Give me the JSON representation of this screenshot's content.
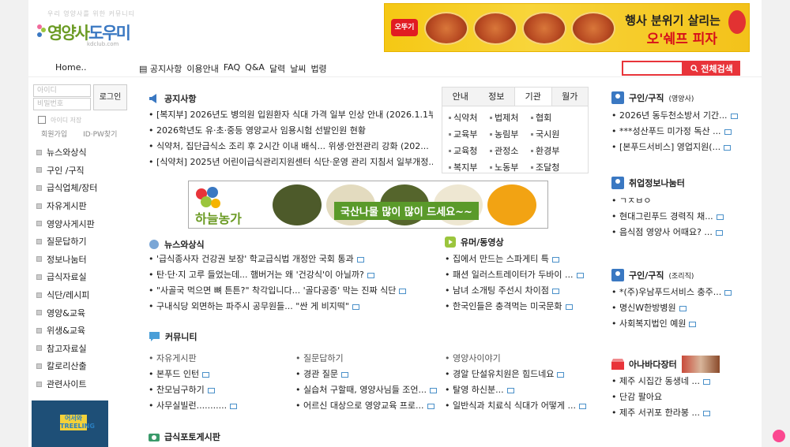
{
  "logo": {
    "tagline": "우리 영양사를 위한 커뮤니티",
    "name_part1": "영양사",
    "name_part2": "도우미",
    "domain": "kdclub.com"
  },
  "top_banner": {
    "brand": "오뚜기",
    "line1": "행사 분위기 살리는",
    "line2": "오'쉐프 피자"
  },
  "nav": {
    "home": "Home..",
    "menu": [
      "공지사항",
      "이용안내",
      "FAQ",
      "Q&A",
      "달력",
      "날씨",
      "법령"
    ]
  },
  "search": {
    "button": "전체검색",
    "placeholder": ""
  },
  "login": {
    "id_placeholder": "아이디",
    "pw_placeholder": "비밀번호",
    "button": "로그인",
    "save_label": "아이디 저장",
    "signup": "회원가입",
    "find": "ID·PW찾기"
  },
  "sidebar": {
    "items": [
      "뉴스와상식",
      "구인 /구직",
      "급식업체/장터",
      "자유게시판",
      "영양사게시판",
      "질문답하기",
      "정보나눔터",
      "급식자료실",
      "식단/레시피",
      "영양&교육",
      "위생&교육",
      "참고자료실",
      "칼로리산출",
      "관련사이트"
    ]
  },
  "side_banner": {
    "text": "어서와 TREELING"
  },
  "notice": {
    "title": "공지사항",
    "rows": [
      "[복지부] 2026년도 병의원 입원환자 식대 가격 일부 인상 안내 (2026.1.1부..",
      "2026학년도 유·초·중등 영양교사 임용시험 선발인원 현황",
      "식약처, 집단급식소 조리 후 2시간 이내 배식... 위생·안전관리 강화 (202...",
      "[식약처] 2025년 어린이급식관리지원센터 식단·운영 관리 지침서 일부개정..."
    ]
  },
  "info_tabs": {
    "tabs": [
      "안내",
      "정보",
      "기관",
      "월가"
    ],
    "active": 2,
    "items": [
      "식약처",
      "법제처",
      "협회",
      "교육부",
      "농림부",
      "국시원",
      "교육청",
      "관정소",
      "환경부",
      "복지부",
      "노동부",
      "조달청"
    ]
  },
  "mid_banner": {
    "logo": "하늘농가",
    "slogan": "국산나물 많이 많이 드세요~~"
  },
  "news": {
    "title": "뉴스와상식",
    "rows": [
      "'급식종사자 건강권 보장' 학교급식법 개정안 국회 통과",
      "탄·단·지 고루 들었는데... 햄버거는 왜 '건강식'이 아닐까?",
      "\"사골국 먹으면 뼈 튼튼?\" 착각입니다... '골다공증' 막는 진짜 식단",
      "구내식당 외면하는 파주시 공무원들... \"싼 게 비지떡\""
    ]
  },
  "humor": {
    "title": "유머/동영상",
    "rows": [
      "집에서 만드는 스파게티 특",
      "패션 일러스트레이터가 두바이 ...",
      "남녀 소개팅 주선시 차이점",
      "한국인들은 충격먹는 미국문화"
    ]
  },
  "community": {
    "title": "커뮤니티",
    "columns": [
      {
        "title": "자유게시판",
        "rows": [
          "본푸드 인턴",
          "찬모님구하기",
          "사무실빌런..........."
        ]
      },
      {
        "title": "질문답하기",
        "rows": [
          "경관 질문",
          "실습처 구할때, 영양사님들 조언...",
          "어르신 대상으로 영양교육 프로..."
        ]
      },
      {
        "title": "영양사이야기",
        "rows": [
          "경알 단설유치원은 힘드네요",
          "탈영 하신분...",
          "일반식과 치료식 식대가 어떻게 ..."
        ]
      }
    ]
  },
  "photo_board": {
    "title": "급식포토게시판"
  },
  "right": {
    "job1": {
      "title": "구인/구직",
      "sub": "(영양사)",
      "rows": [
        "2026년 동두천소방서 기간...",
        "***성산푸드 미가정 독산 ...",
        "[본푸드서비스] 영업지원(..."
      ]
    },
    "job_farm": {
      "title": "취업정보나눔터",
      "rows": [
        "ㄱㅈㅂㅇ",
        "현대그린푸드 경력직 채...",
        "음식점 영양사 어때요? ..."
      ]
    },
    "job2": {
      "title": "구인/구직",
      "sub": "(조리직)",
      "rows": [
        "*(주)우남푸드서비스 충주...",
        "명신W한방병원",
        "사회복지법인 예원"
      ]
    },
    "market": {
      "title": "아나바다장터",
      "rows": [
        "제주 시집간 동생네 ...",
        "단감 팔아요",
        "제주 서귀포 한라봉 ..."
      ]
    }
  },
  "colors": {
    "accent": "#e8343a",
    "brand_green": "#6b9b24",
    "brand_blue": "#3a78c2"
  }
}
